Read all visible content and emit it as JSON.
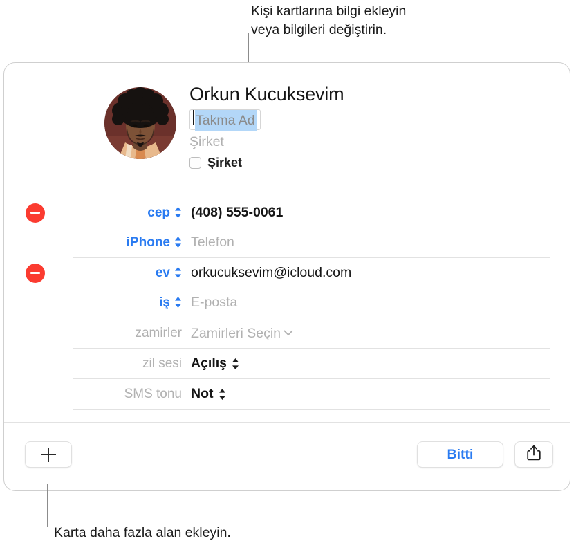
{
  "callouts": {
    "top": "Kişi kartlarına bilgi ekleyin\nveya bilgileri değiştirin.",
    "bottom": "Karta daha fazla alan ekleyin."
  },
  "card": {
    "header": {
      "avatar_alt": "contact-photo",
      "name": "Orkun  Kucuksevim",
      "nickname_placeholder": "Takma Ad",
      "company_placeholder": "Şirket",
      "company_checkbox_label": "Şirket",
      "company_checkbox_checked": false
    },
    "fields": [
      {
        "removable": true,
        "rows": [
          {
            "label": "cep",
            "label_style": "link",
            "control": "stepper",
            "value": "(408) 555-0061",
            "value_style": "strong"
          },
          {
            "label": "iPhone",
            "label_style": "link",
            "control": "stepper",
            "value": "Telefon",
            "value_style": "placeholder"
          }
        ]
      },
      {
        "removable": true,
        "rows": [
          {
            "label": "ev",
            "label_style": "link",
            "control": "stepper",
            "value": "orkucuksevim@icloud.com",
            "value_style": "plain"
          },
          {
            "label": "iş",
            "label_style": "link",
            "control": "stepper",
            "value": "E-posta",
            "value_style": "placeholder"
          }
        ]
      },
      {
        "removable": false,
        "rows": [
          {
            "label": "zamirler",
            "label_style": "muted",
            "control": "none",
            "value": "Zamirleri Seçin",
            "value_style": "placeholder",
            "value_control": "chevron"
          }
        ]
      },
      {
        "removable": false,
        "rows": [
          {
            "label": "zil sesi",
            "label_style": "muted",
            "control": "none",
            "value": "Açılış",
            "value_style": "strong",
            "value_control": "stepper"
          }
        ]
      },
      {
        "removable": false,
        "rows": [
          {
            "label": "SMS tonu",
            "label_style": "muted",
            "control": "none",
            "value": "Not",
            "value_style": "strong",
            "value_control": "stepper"
          }
        ]
      }
    ],
    "toolbar": {
      "add_field_icon": "plus-icon",
      "done_label": "Bitti",
      "share_icon": "share-icon"
    }
  },
  "colors": {
    "accent_blue": "#2a7bf1",
    "remove_red": "#fb3b30",
    "selection_blue": "#b3d7f8",
    "separator": "#e2e2e2",
    "placeholder_gray": "#b1b1b1"
  }
}
